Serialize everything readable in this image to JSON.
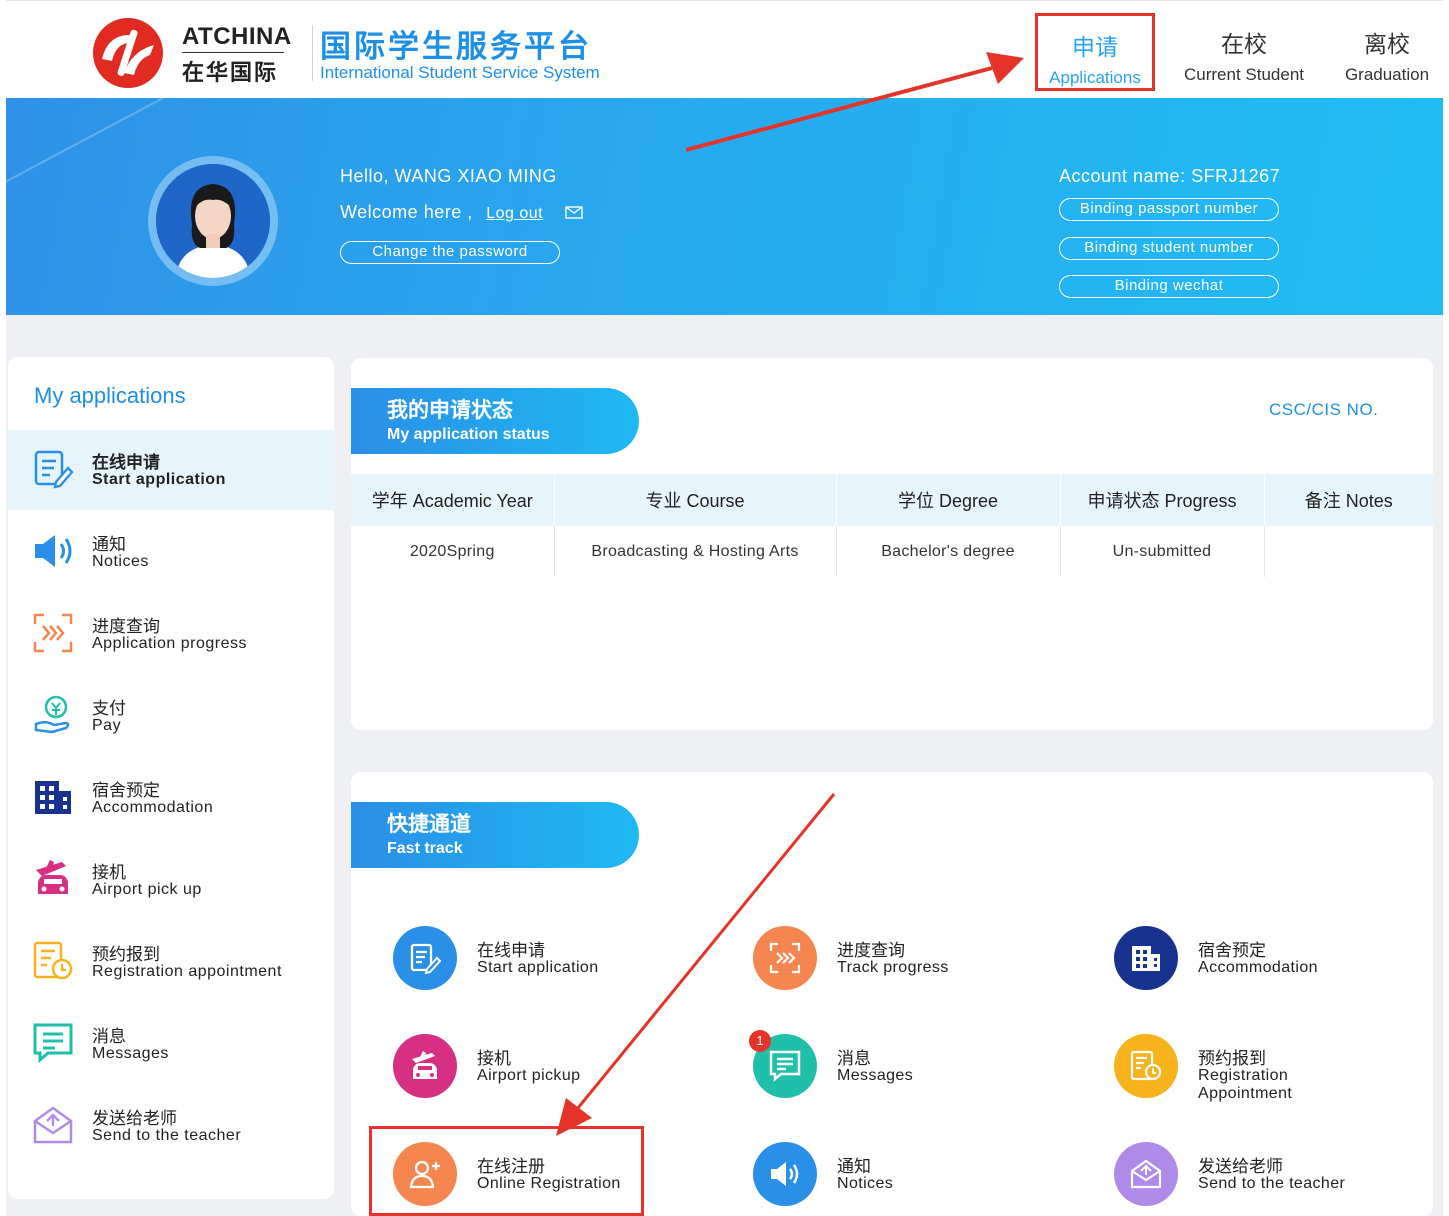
{
  "header": {
    "logo_en": "ATCHINA",
    "logo_cn": "在华国际",
    "system_cn": "国际学生服务平台",
    "system_en": "International Student Service System",
    "nav": [
      {
        "cn": "申请",
        "en": "Applications"
      },
      {
        "cn": "在校",
        "en": "Current Student"
      },
      {
        "cn": "离校",
        "en": "Graduation"
      }
    ]
  },
  "banner": {
    "hello": "Hello,  WANG XIAO MING",
    "welcome": "Welcome here ,",
    "logout": "Log out",
    "change_password": "Change the password",
    "account": "Account name:  SFRJ1267",
    "bind_passport": "Binding passport number",
    "bind_student": "Binding student number",
    "bind_wechat": "Binding wechat"
  },
  "sidebar": {
    "title": "My applications",
    "items": [
      {
        "cn": "在线申请",
        "en": "Start application",
        "icon": "form-edit-icon"
      },
      {
        "cn": "通知",
        "en": "Notices",
        "icon": "speaker-icon"
      },
      {
        "cn": "进度查询",
        "en": "Application progress",
        "icon": "progress-scan-icon"
      },
      {
        "cn": "支付",
        "en": "Pay",
        "icon": "pay-hand-icon"
      },
      {
        "cn": "宿舍预定",
        "en": "Accommodation",
        "icon": "building-icon"
      },
      {
        "cn": "接机",
        "en": "Airport pick up",
        "icon": "car-plane-icon"
      },
      {
        "cn": "预约报到",
        "en": "Registration appointment",
        "icon": "calendar-clock-icon"
      },
      {
        "cn": "消息",
        "en": "Messages",
        "icon": "message-icon"
      },
      {
        "cn": "发送给老师",
        "en": "Send to the teacher",
        "icon": "envelope-icon"
      }
    ]
  },
  "status": {
    "title_cn": "我的申请状态",
    "title_en": "My application status",
    "csc": "CSC/CIS NO.",
    "columns": [
      "学年 Academic Year",
      "专业 Course",
      "学位 Degree",
      "申请状态 Progress",
      "备注 Notes"
    ],
    "rows": [
      [
        "2020Spring",
        "Broadcasting & Hosting Arts",
        "Bachelor's degree",
        "Un-submitted",
        ""
      ]
    ]
  },
  "fast": {
    "title_cn": "快捷通道",
    "title_en": "Fast track",
    "items": [
      {
        "cn": "在线申请",
        "en": "Start application",
        "color": "#2a8fe6"
      },
      {
        "cn": "进度查询",
        "en": "Track progress",
        "color": "#f5864f"
      },
      {
        "cn": "宿舍预定",
        "en": "Accommodation",
        "color": "#18338f"
      },
      {
        "cn": "接机",
        "en": "Airport pickup",
        "color": "#d62f84"
      },
      {
        "cn": "消息",
        "en": "Messages",
        "color": "#1fbfa9",
        "badge": "1"
      },
      {
        "cn": "预约报到",
        "en": "Registration Appointment",
        "color": "#f7b21c"
      },
      {
        "cn": "在线注册",
        "en": "Online Registration",
        "color": "#f5864f"
      },
      {
        "cn": "通知",
        "en": "Notices",
        "color": "#2a8fe6"
      },
      {
        "cn": "发送给老师",
        "en": "Send to the teacher",
        "color": "#b08ae8"
      }
    ]
  },
  "colors": {
    "accent": "#1e8fe6",
    "highlight": "#e5332a",
    "banner": "#27a9ef"
  }
}
